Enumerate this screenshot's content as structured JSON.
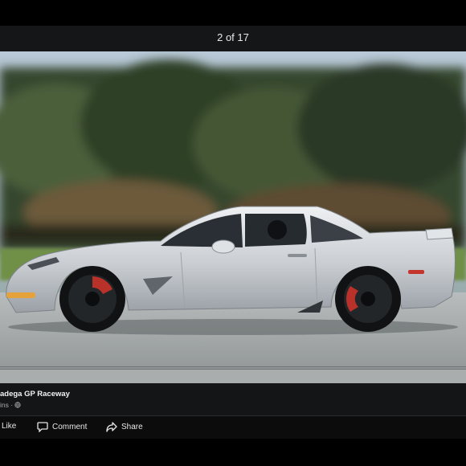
{
  "viewer": {
    "counter": "2 of 17"
  },
  "post": {
    "place": "adega GP Raceway",
    "meta": "ins ·"
  },
  "actions": {
    "like": "Like",
    "comment": "Comment",
    "share": "Share"
  },
  "colors": {
    "header_bg": "#151618",
    "caption_bg": "#141516",
    "text": "#f2f2f2",
    "muted": "#a8a9ab"
  },
  "icons": [
    "like-icon",
    "comment-icon",
    "share-icon",
    "globe-icon"
  ]
}
